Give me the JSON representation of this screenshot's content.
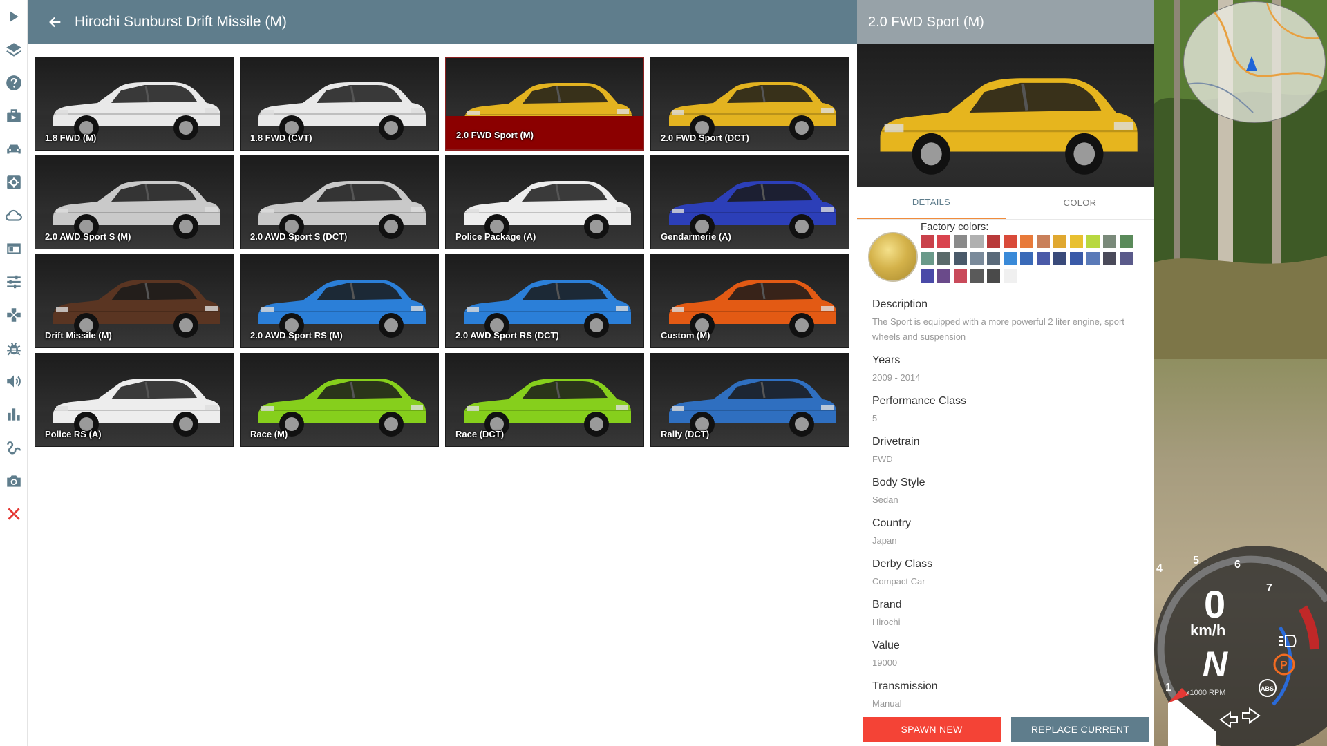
{
  "header": {
    "title": "Hirochi Sunburst Drift Missile (M)"
  },
  "configs": [
    {
      "label": "1.8 FWD (M)",
      "color": "#e9e9e9"
    },
    {
      "label": "1.8 FWD (CVT)",
      "color": "#e9e9e9"
    },
    {
      "label": "2.0 FWD Sport (M)",
      "color": "#e3b320",
      "selected": true
    },
    {
      "label": "2.0 FWD Sport (DCT)",
      "color": "#e3b320"
    },
    {
      "label": "2.0 AWD Sport S (M)",
      "color": "#c9c9c9"
    },
    {
      "label": "2.0 AWD Sport S (DCT)",
      "color": "#c9c9c9"
    },
    {
      "label": "Police Package (A)",
      "color": "#ededed"
    },
    {
      "label": "Gendarmerie (A)",
      "color": "#2c3fb8"
    },
    {
      "label": "Drift Missile (M)",
      "color": "#5a3522"
    },
    {
      "label": "2.0 AWD Sport RS (M)",
      "color": "#2b7fd8"
    },
    {
      "label": "2.0 AWD Sport RS (DCT)",
      "color": "#2b7fd8"
    },
    {
      "label": "Custom (M)",
      "color": "#e35a14"
    },
    {
      "label": "Police RS (A)",
      "color": "#ededed"
    },
    {
      "label": "Race (M)",
      "color": "#86cf1c"
    },
    {
      "label": "Race (DCT)",
      "color": "#86cf1c"
    },
    {
      "label": "Rally (DCT)",
      "color": "#2f6fc0"
    }
  ],
  "panel": {
    "title": "2.0 FWD Sport (M)",
    "preview_color": "#e6b51e",
    "tabs": [
      "DETAILS",
      "COLOR"
    ],
    "factory_colors_label": "Factory colors:",
    "factory_colors": [
      "#c9414a",
      "#d9444e",
      "#8a8a8a",
      "#b0b0b0",
      "#b93a3a",
      "#d94a3a",
      "#e87a3a",
      "#c9805a",
      "#e0a830",
      "#e8c030",
      "#b8d840",
      "#7a8a7a",
      "#5a8a5a",
      "#6a9a8a",
      "#5a6a6a",
      "#4a5a6a",
      "#7a8a9a",
      "#5a6a7a",
      "#3a8ad8",
      "#3a6ab8",
      "#4a5aa8",
      "#3a4a7a",
      "#3a5aa8",
      "#5a7ab8",
      "#4a4a5a",
      "#5a5a8a",
      "#4a4aa8",
      "#6a4a8a",
      "#c94a5a",
      "#5a5a5a",
      "#4a4a4a",
      "#f0f0f0"
    ],
    "details": [
      {
        "key": "Description",
        "value": "The Sport is equipped with a more powerful 2 liter engine, sport wheels and suspension"
      },
      {
        "key": "Years",
        "value": "2009 - 2014"
      },
      {
        "key": "Performance Class",
        "value": "5"
      },
      {
        "key": "Drivetrain",
        "value": "FWD"
      },
      {
        "key": "Body Style",
        "value": "Sedan"
      },
      {
        "key": "Country",
        "value": "Japan"
      },
      {
        "key": "Derby Class",
        "value": "Compact Car"
      },
      {
        "key": "Brand",
        "value": "Hirochi"
      },
      {
        "key": "Value",
        "value": "19000"
      },
      {
        "key": "Transmission",
        "value": "Manual"
      }
    ],
    "spawn_label": "SPAWN NEW",
    "replace_label": "REPLACE CURRENT"
  },
  "hud": {
    "speed": "0",
    "speed_unit": "km/h",
    "gear": "N",
    "rpm_unit": "x1000 RPM",
    "rpm_ticks": [
      "1",
      "4",
      "5",
      "6",
      "7"
    ],
    "abs_label": "ABS",
    "parking_label": "P"
  },
  "sidebar_icons": [
    "play-icon",
    "layers-icon",
    "help-icon",
    "mission-icon",
    "car-icon",
    "vehicle-config-icon",
    "cloud-icon",
    "app-window-icon",
    "sliders-icon",
    "gamepad-icon",
    "debug-icon",
    "volume-icon",
    "stats-icon",
    "track-icon",
    "camera-icon",
    "close-icon"
  ]
}
